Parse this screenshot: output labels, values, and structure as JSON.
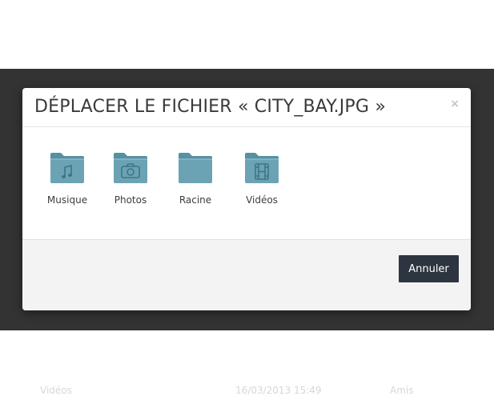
{
  "background_row": {
    "name": "Vidéos",
    "date": "16/03/2013 15:49",
    "shared": "Amis"
  },
  "dialog": {
    "title": "DÉPLACER LE FICHIER « CITY_BAY.JPG »",
    "close_label": "×",
    "folders": [
      {
        "label": "Musique",
        "icon": "music-folder-icon"
      },
      {
        "label": "Photos",
        "icon": "camera-folder-icon"
      },
      {
        "label": "Racine",
        "icon": "folder-icon"
      },
      {
        "label": "Vidéos",
        "icon": "film-folder-icon"
      }
    ],
    "cancel_label": "Annuler"
  },
  "colors": {
    "backdrop": "#333333",
    "folder": "#6ba3b5",
    "folder_tab": "#5690a3",
    "button": "#2c3540"
  }
}
